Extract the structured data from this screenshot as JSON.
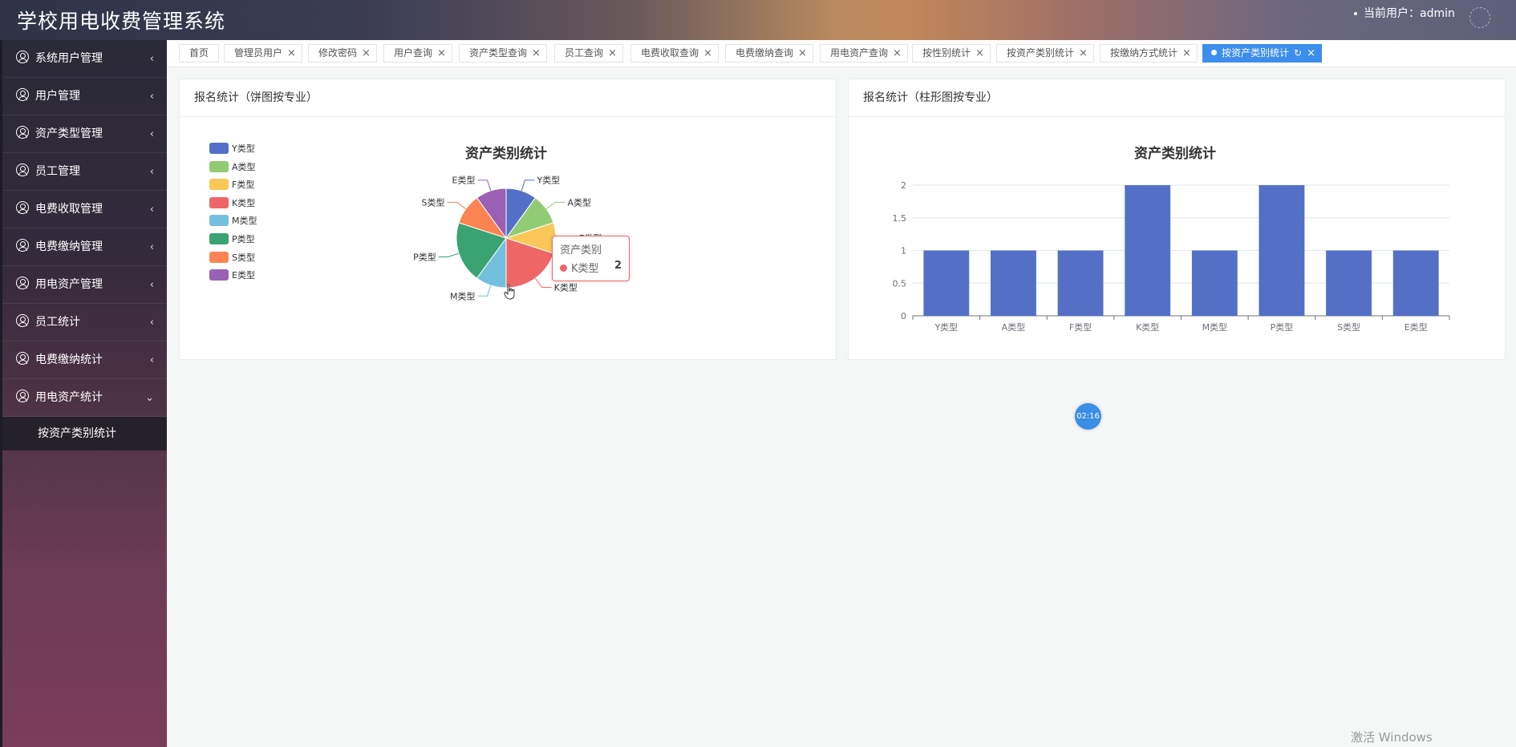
{
  "app": {
    "title": "学校用电收费管理系统",
    "current_user": "当前用户：admin"
  },
  "sidebar": {
    "items": [
      {
        "label": "系统用户管理",
        "chevron": "‹"
      },
      {
        "label": "用户管理",
        "chevron": "‹"
      },
      {
        "label": "资产类型管理",
        "chevron": "‹"
      },
      {
        "label": "员工管理",
        "chevron": "‹"
      },
      {
        "label": "电费收取管理",
        "chevron": "‹"
      },
      {
        "label": "电费缴纳管理",
        "chevron": "‹"
      },
      {
        "label": "用电资产管理",
        "chevron": "‹"
      },
      {
        "label": "员工统计",
        "chevron": "‹"
      },
      {
        "label": "电费缴纳统计",
        "chevron": "‹"
      },
      {
        "label": "用电资产统计",
        "chevron": "⌄"
      }
    ],
    "submenu": [
      {
        "label": "按资产类别统计"
      }
    ]
  },
  "tabs": [
    {
      "label": "首页"
    },
    {
      "label": "管理员用户"
    },
    {
      "label": "修改密码"
    },
    {
      "label": "用户查询"
    },
    {
      "label": "资产类型查询"
    },
    {
      "label": "员工查询"
    },
    {
      "label": "电费收取查询"
    },
    {
      "label": "电费缴纳查询"
    },
    {
      "label": "用电资产查询"
    },
    {
      "label": "按性别统计"
    },
    {
      "label": "按资产类别统计"
    },
    {
      "label": "按缴纳方式统计"
    },
    {
      "label": "按资产类别统计",
      "active": true
    }
  ],
  "tab_close": "×",
  "tab_refresh": "↻",
  "cards": {
    "pie": {
      "header": "报名统计（饼图按专业）"
    },
    "bar": {
      "header": "报名统计（柱形图按专业）"
    }
  },
  "chart_data": [
    {
      "type": "pie",
      "title": "资产类别统计",
      "categories": [
        "Y类型",
        "A类型",
        "F类型",
        "K类型",
        "M类型",
        "P类型",
        "S类型",
        "E类型"
      ],
      "values": [
        1,
        1,
        1,
        2,
        1,
        2,
        1,
        1
      ],
      "colors": [
        "#5470c6",
        "#91cc75",
        "#fac858",
        "#ee6666",
        "#73c0de",
        "#3ba272",
        "#fc8452",
        "#9a60b4"
      ],
      "legend_position": "top-left",
      "tooltip": {
        "title": "资产类别",
        "name": "K类型",
        "value": "2"
      }
    },
    {
      "type": "bar",
      "title": "资产类别统计",
      "categories": [
        "Y类型",
        "A类型",
        "F类型",
        "K类型",
        "M类型",
        "P类型",
        "S类型",
        "E类型"
      ],
      "values": [
        1,
        1,
        1,
        2,
        1,
        2,
        1,
        1
      ],
      "yticks": [
        "0",
        "0.5",
        "1",
        "1.5",
        "2"
      ],
      "ylim": [
        0,
        2
      ],
      "color": "#5470c6",
      "grid": true
    }
  ],
  "timer": {
    "text": "02:16"
  },
  "watermark": {
    "text": "激活 Windows"
  }
}
